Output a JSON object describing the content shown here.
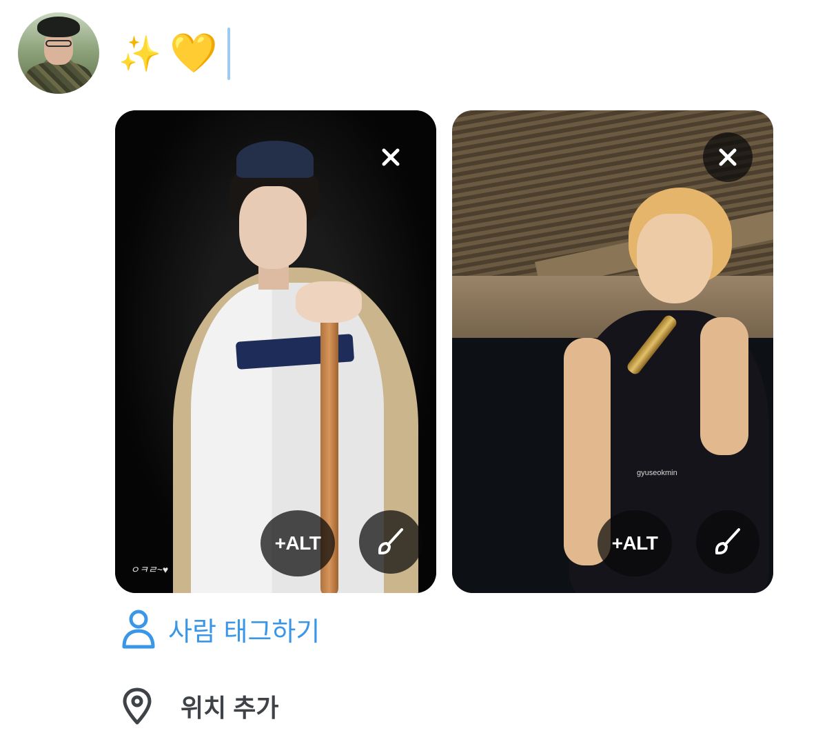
{
  "compose": {
    "text": "✨💛",
    "sparkles_emoji": "✨",
    "heart_emoji": "💛"
  },
  "user": {
    "avatar_icon": "profile-avatar"
  },
  "media": [
    {
      "alt_label": "+ALT",
      "close_icon": "close-icon",
      "edit_icon": "brush-icon",
      "watermark": "ㅇㅋㄹ~♥"
    },
    {
      "alt_label": "+ALT",
      "close_icon": "close-icon",
      "edit_icon": "brush-icon",
      "watermark": "gyuseokmin"
    }
  ],
  "actions": {
    "tag_people": "사람 태그하기",
    "add_location": "위치 추가"
  },
  "colors": {
    "accent": "#3a97e8",
    "caret": "#9ccaf2",
    "muted_text": "#3f4347",
    "overlay": "#0a0a0a"
  }
}
